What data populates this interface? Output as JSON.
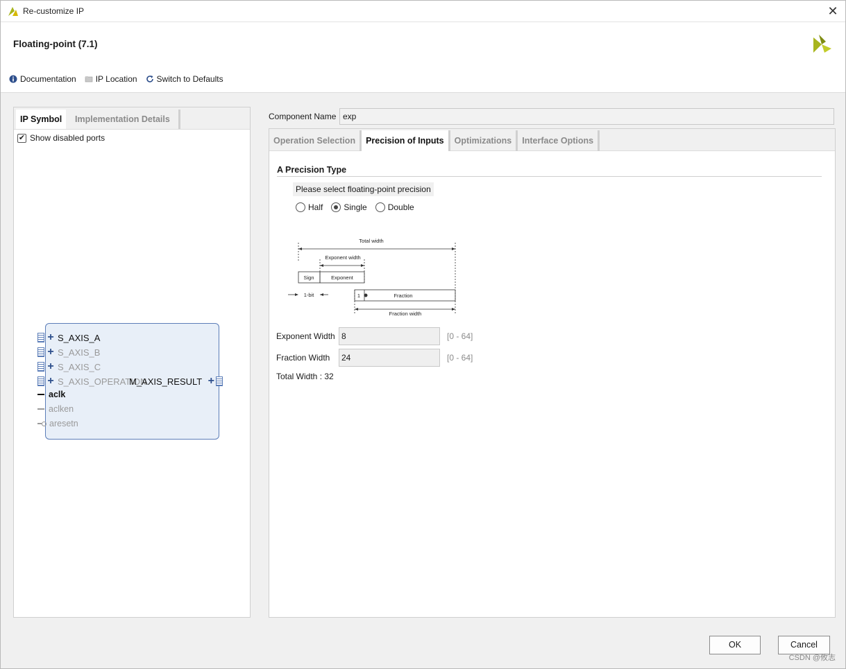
{
  "window": {
    "title": "Re-customize IP",
    "close_label": "✕"
  },
  "header": {
    "ip_title": "Floating-point (7.1)"
  },
  "toolbar": {
    "documentation": "Documentation",
    "ip_location": "IP Location",
    "switch_defaults": "Switch to Defaults"
  },
  "left_panel": {
    "tabs": [
      {
        "label": "IP Symbol",
        "active": true
      },
      {
        "label": "Implementation Details",
        "active": false
      }
    ],
    "show_disabled_ports": {
      "label": "Show disabled ports",
      "checked": true
    },
    "ports": {
      "inputs": [
        {
          "name": "S_AXIS_A",
          "enabled": true,
          "type": "bus"
        },
        {
          "name": "S_AXIS_B",
          "enabled": false,
          "type": "bus"
        },
        {
          "name": "S_AXIS_C",
          "enabled": false,
          "type": "bus"
        },
        {
          "name": "S_AXIS_OPERATION",
          "enabled": false,
          "type": "bus"
        },
        {
          "name": "aclk",
          "enabled": true,
          "type": "wire"
        },
        {
          "name": "aclken",
          "enabled": false,
          "type": "wire"
        },
        {
          "name": "aresetn",
          "enabled": false,
          "type": "wire"
        }
      ],
      "outputs": [
        {
          "name": "M_AXIS_RESULT",
          "enabled": true,
          "type": "bus"
        }
      ]
    }
  },
  "component": {
    "label": "Component Name",
    "value": "exp"
  },
  "right_tabs": [
    {
      "label": "Operation Selection",
      "active": false
    },
    {
      "label": "Precision of Inputs",
      "active": true
    },
    {
      "label": "Optimizations",
      "active": false
    },
    {
      "label": "Interface Options",
      "active": false
    }
  ],
  "precision": {
    "section_title": "A Precision Type",
    "prompt": "Please select floating-point precision",
    "options": [
      {
        "label": "Half",
        "selected": false
      },
      {
        "label": "Single",
        "selected": true
      },
      {
        "label": "Double",
        "selected": false
      }
    ],
    "diagram": {
      "total_width": "Total width",
      "exponent_width": "Exponent width",
      "sign": "Sign",
      "exponent": "Exponent",
      "one_bit": "1-bit",
      "one": "1",
      "fraction": "Fraction",
      "fraction_width": "Fraction width"
    },
    "exponent_width": {
      "label": "Exponent Width",
      "value": "8",
      "range": "[0 - 64]"
    },
    "fraction_width": {
      "label": "Fraction Width",
      "value": "24",
      "range": "[0 - 64]"
    },
    "total_width": "Total Width : 32"
  },
  "buttons": {
    "ok": "OK",
    "cancel": "Cancel"
  },
  "watermark": "CSDN @攸志",
  "colors": {
    "accent": "#5b7db8",
    "logo": "#a8b51e"
  }
}
